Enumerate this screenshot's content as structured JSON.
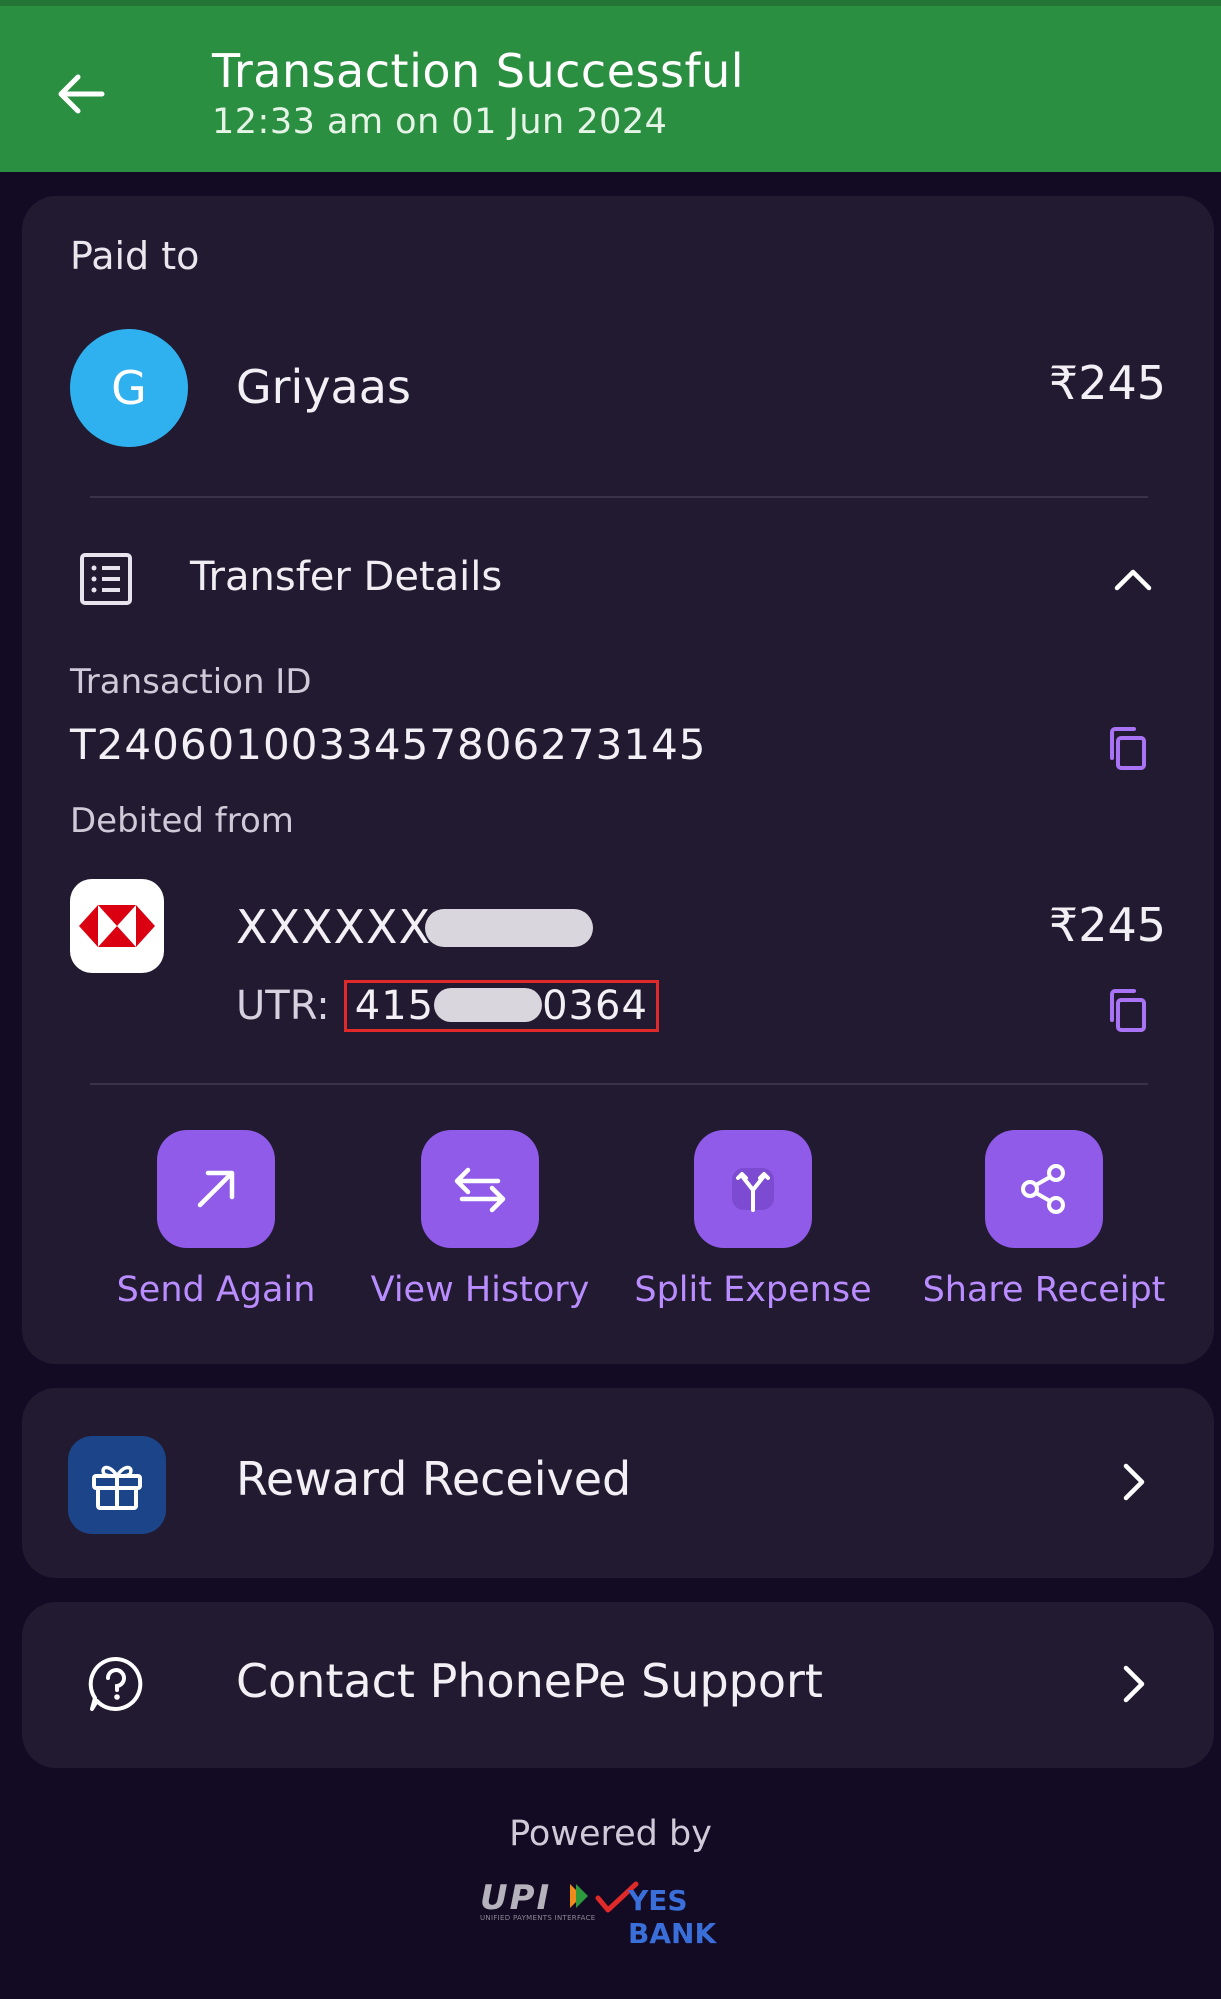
{
  "header": {
    "title": "Transaction Successful",
    "subtitle": "12:33 am on 01 Jun 2024",
    "back_icon": "arrow-left-icon",
    "color": "#2b8f42"
  },
  "payment": {
    "paid_to_label": "Paid to",
    "avatar_letter": "G",
    "payee_name": "Griyaas",
    "amount": "₹245",
    "avatar_color": "#2fb1ef"
  },
  "transfer_details": {
    "title": "Transfer Details",
    "transaction_id_label": "Transaction ID",
    "transaction_id": "T2406010033457806273145",
    "debited_from_label": "Debited from",
    "account_prefix": "XXXXXX",
    "debit_amount": "₹245",
    "utr_label": "UTR:",
    "utr_start": "415",
    "utr_end": "0364"
  },
  "actions": [
    {
      "label": "Send Again",
      "icon": "arrow-up-right-icon"
    },
    {
      "label": "View History",
      "icon": "swap-arrows-icon"
    },
    {
      "label": "Split Expense",
      "icon": "split-icon"
    },
    {
      "label": "Share Receipt",
      "icon": "share-icon"
    }
  ],
  "reward": {
    "label": "Reward Received",
    "icon": "gift-icon"
  },
  "support": {
    "label": "Contact PhonePe Support",
    "icon": "help-circle-icon"
  },
  "footer": {
    "powered_by": "Powered by",
    "upi": "UPI",
    "upi_sub": "UNIFIED PAYMENTS INTERFACE",
    "bank": "YES BANK"
  },
  "colors": {
    "background": "#130a24",
    "card": "#221a31",
    "accent": "#8f5be8",
    "accent_text": "#b98cff",
    "highlight_border": "#e02929"
  }
}
